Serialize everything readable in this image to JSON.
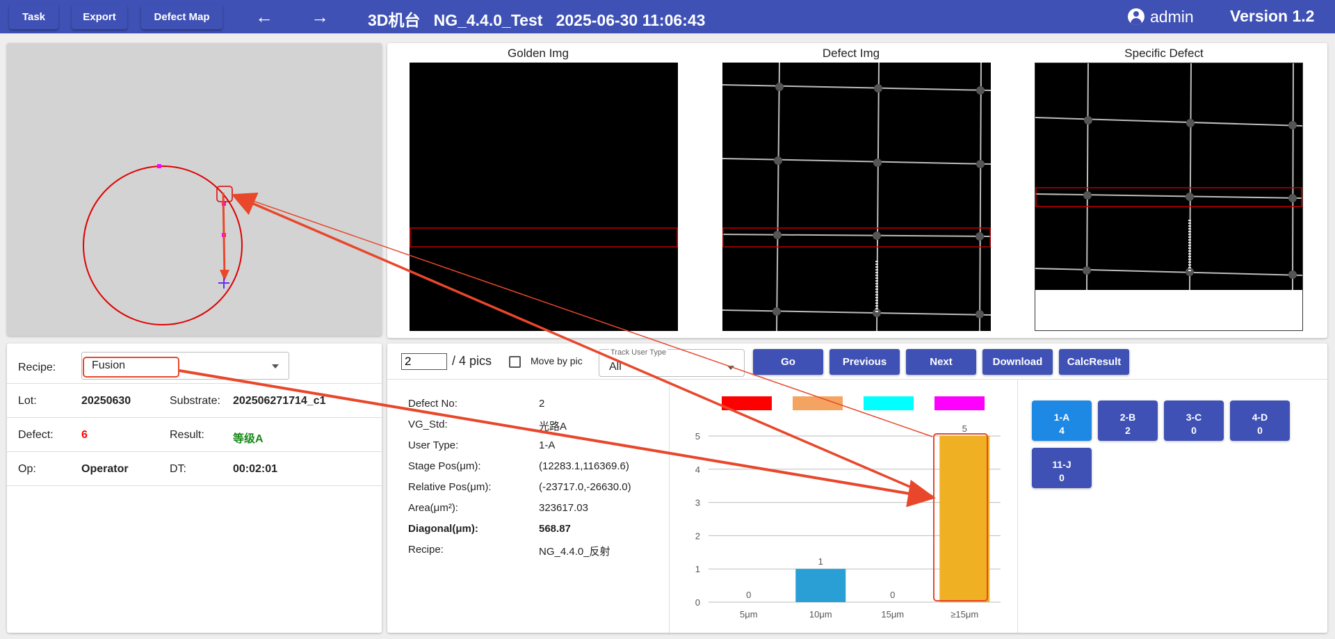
{
  "toolbar": {
    "task": "Task",
    "export": "Export",
    "defect_map": "Defect Map"
  },
  "header": {
    "machine": "3D机台",
    "recipe_name": "NG_4.4.0_Test",
    "datetime": "2025-06-30 11:06:43",
    "user": "admin",
    "version": "Version 1.2"
  },
  "images": {
    "golden": "Golden Img",
    "defect": "Defect Img",
    "specific": "Specific Defect"
  },
  "info": {
    "recipe_label": "Recipe:",
    "recipe_value": "Fusion",
    "lot_label": "Lot:",
    "lot_value": "20250630",
    "substrate_label": "Substrate:",
    "substrate_value": "202506271714_c1",
    "defect_label": "Defect:",
    "defect_value": "6",
    "result_label": "Result:",
    "result_value": "等级A",
    "op_label": "Op:",
    "op_value": "Operator",
    "dt_label": "DT:",
    "dt_value": "00:02:01",
    "defect_color": "#ff0000",
    "result_color": "#1a8a1a"
  },
  "pager": {
    "current": "2",
    "total": "/ 4 pics",
    "move_by_pic": "Move by pic",
    "move_by_pic_checked": false,
    "track_label": "Track User Type",
    "track_value": "All",
    "go": "Go",
    "previous": "Previous",
    "next": "Next",
    "download": "Download",
    "calc": "CalcResult"
  },
  "details": [
    {
      "label": "Defect No:",
      "value": "2",
      "bold": false
    },
    {
      "label": "VG_Std:",
      "value": "光路A",
      "bold": false
    },
    {
      "label": "User Type:",
      "value": "1-A",
      "bold": false
    },
    {
      "label": "Stage Pos(μm):",
      "value": "(12283.1,116369.6)",
      "bold": false
    },
    {
      "label": "Relative Pos(μm):",
      "value": "(-23717.0,-26630.0)",
      "bold": false
    },
    {
      "label": "Area(μm²):",
      "value": "323617.03",
      "bold": false
    },
    {
      "label": "Diagonal(μm):",
      "value": "568.87",
      "bold": true
    },
    {
      "label": "Recipe:",
      "value": "NG_4.4.0_反射",
      "bold": false
    }
  ],
  "user_types": [
    {
      "name": "1-A",
      "count": "4",
      "active": true
    },
    {
      "name": "2-B",
      "count": "2",
      "active": false
    },
    {
      "name": "3-C",
      "count": "0",
      "active": false
    },
    {
      "name": "4-D",
      "count": "0",
      "active": false
    },
    {
      "name": "11-J",
      "count": "0",
      "active": false
    }
  ],
  "colors": {
    "primary": "#3f51b5",
    "active_type": "#1e88e5",
    "annotation": "#e8472b",
    "legend": [
      "#ff0000",
      "#f4a460",
      "#00ffff",
      "#ff00ff"
    ]
  },
  "chart_data": {
    "type": "bar",
    "categories": [
      "5μm",
      "10μm",
      "15μm",
      "≥15μm"
    ],
    "values": [
      0,
      1,
      0,
      5
    ],
    "bar_colors": [
      "#2a9fd6",
      "#2a9fd6",
      "#2a9fd6",
      "#f0b023"
    ],
    "legend_colors": [
      "#ff0000",
      "#f4a460",
      "#00ffff",
      "#ff00ff"
    ],
    "ylim": [
      0,
      5
    ],
    "yticks": [
      "0",
      "1",
      "2",
      "3",
      "4",
      "5"
    ],
    "grid": true,
    "highlighted_category": "≥15μm"
  }
}
